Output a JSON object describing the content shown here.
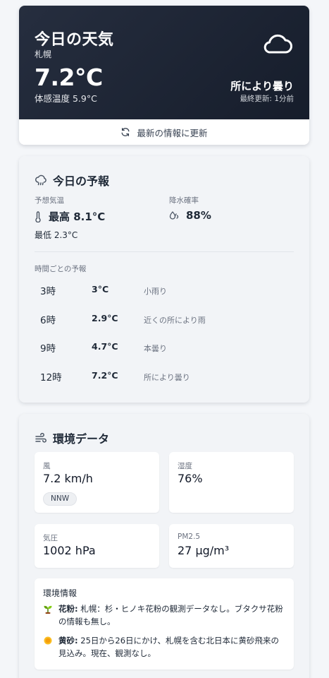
{
  "hero": {
    "title": "今日の天気",
    "city": "札幌",
    "temperature": "7.2°C",
    "feels_like": "体感温度 5.9°C",
    "condition": "所により曇り",
    "updated": "最終更新: 1分前",
    "icon": "cloud-icon",
    "refresh_label": "最新の情報に更新"
  },
  "forecast": {
    "title": "今日の予報",
    "temp_label": "予想気温",
    "high": "最高 8.1°C",
    "low": "最低 2.3°C",
    "rain_label": "降水確率",
    "rain": "88%",
    "hourly_title": "時間ごとの予報",
    "hourly": [
      {
        "hour": "3時",
        "temp": "3°C",
        "cond": "小雨り"
      },
      {
        "hour": "6時",
        "temp": "2.9°C",
        "cond": "近くの所により雨"
      },
      {
        "hour": "9時",
        "temp": "4.7°C",
        "cond": "本曇り"
      },
      {
        "hour": "12時",
        "temp": "7.2°C",
        "cond": "所により曇り"
      }
    ]
  },
  "env": {
    "title": "環境データ",
    "wind_label": "風",
    "wind": "7.2 km/h",
    "wind_dir": "NNW",
    "humidity_label": "湿度",
    "humidity": "76%",
    "pressure_label": "気圧",
    "pressure": "1002 hPa",
    "pm_label": "PM2.5",
    "pm": "27 µg/m³",
    "info_title": "環境情報",
    "pollen_label": "花粉:",
    "pollen_text": "札幌：杉・ヒノキ花粉の観測データなし。ブタクサ花粉の情報も無し。",
    "dust_label": "黄砂:",
    "dust_text": "25日から26日にかけ、札幌を含む北日本に黄砂飛来の見込み。現在、観測なし。"
  },
  "colors": {
    "hero_bg": "#1b2232",
    "page_bg": "#f4f6f9",
    "card_bg": "#f2f4f7"
  }
}
